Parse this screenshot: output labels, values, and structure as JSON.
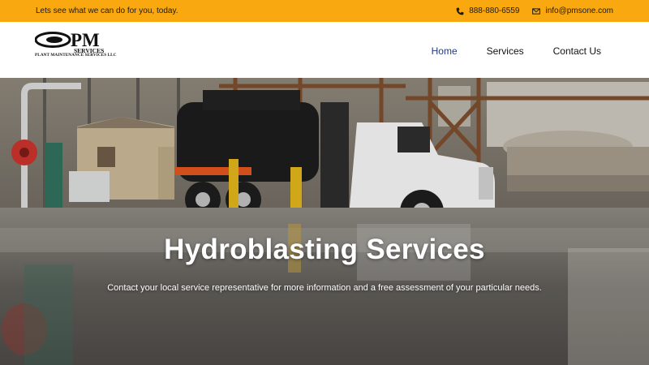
{
  "topbar": {
    "tagline": "Lets see what we can do for you, today.",
    "phone": "888-880-6559",
    "email": "info@pmsone.com",
    "phone_icon": "phone-icon",
    "email_icon": "envelope-icon"
  },
  "logo": {
    "mark": "PM",
    "services": "SERVICES",
    "subtitle": "PLANT MAINTENANCE SERVICES LLC"
  },
  "nav": {
    "items": [
      {
        "label": "Home",
        "active": true
      },
      {
        "label": "Services",
        "active": false
      },
      {
        "label": "Contact Us",
        "active": false
      }
    ]
  },
  "hero": {
    "title": "Hydroblasting Services",
    "subtitle": "Contact your local service representative for more information and a free assessment of your particular needs."
  },
  "colors": {
    "topbar_bg": "#f9a90f",
    "nav_active": "#1f3c88"
  }
}
